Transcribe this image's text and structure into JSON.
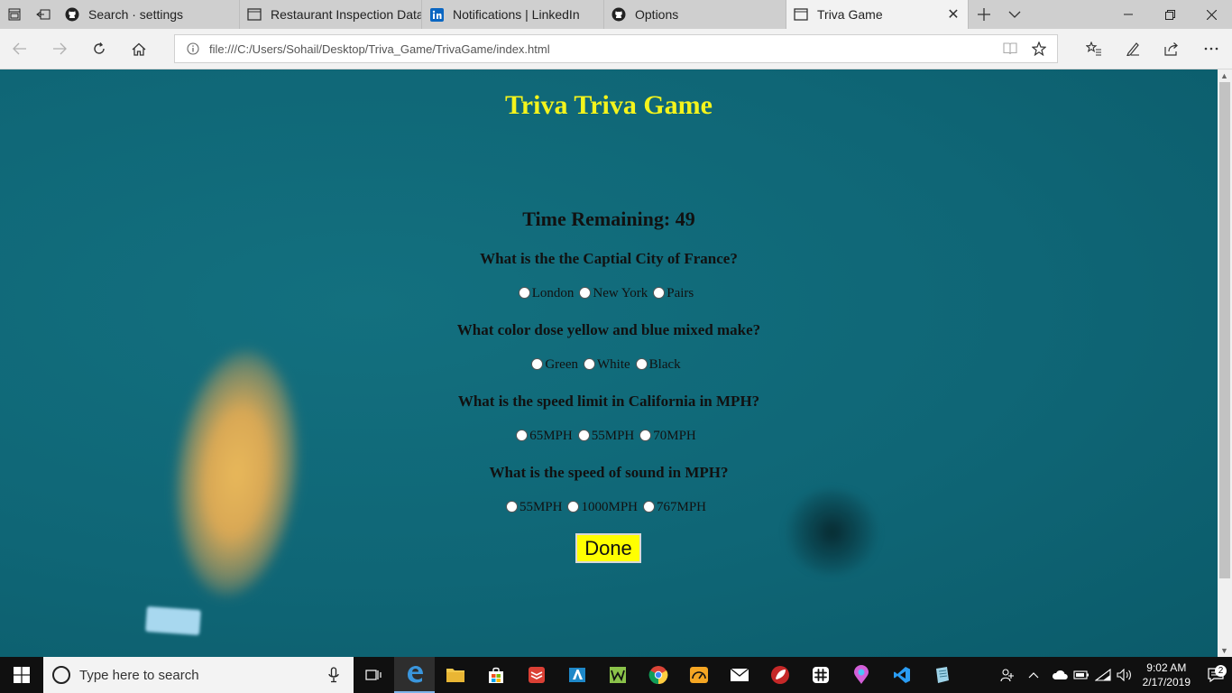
{
  "browser": {
    "tabs": [
      {
        "label": "Search · settings",
        "icon": "github-icon"
      },
      {
        "label": "Restaurant Inspection Data",
        "icon": "page-icon"
      },
      {
        "label": "Notifications | LinkedIn",
        "icon": "linkedin-icon"
      },
      {
        "label": "Options",
        "icon": "github-icon"
      },
      {
        "label": "Triva Game",
        "icon": "page-icon",
        "active": true
      }
    ],
    "address": {
      "url": "file:///C:/Users/Sohail/Desktop/Triva_Game/TrivaGame/index.html"
    }
  },
  "page": {
    "title": "Triva Triva Game",
    "timer": "Time Remaining: 49",
    "questions": [
      {
        "text": "What is the the Captial City of France?",
        "options": [
          "London",
          "New York",
          "Pairs"
        ]
      },
      {
        "text": "What color dose yellow and blue mixed make?",
        "options": [
          "Green",
          "White",
          "Black"
        ]
      },
      {
        "text": "What is the speed limit in California in MPH?",
        "options": [
          "65MPH",
          "55MPH",
          "70MPH"
        ]
      },
      {
        "text": "What is the speed of sound in MPH?",
        "options": [
          "55MPH",
          "1000MPH",
          "767MPH"
        ]
      }
    ],
    "done_label": "Done"
  },
  "taskbar": {
    "search_placeholder": "Type here to search",
    "time": "9:02 AM",
    "date": "2/17/2019",
    "notification_count": "2"
  },
  "colors": {
    "page_background": "#0e6474",
    "title": "#f4f41c",
    "done_button": "#ffff00"
  }
}
